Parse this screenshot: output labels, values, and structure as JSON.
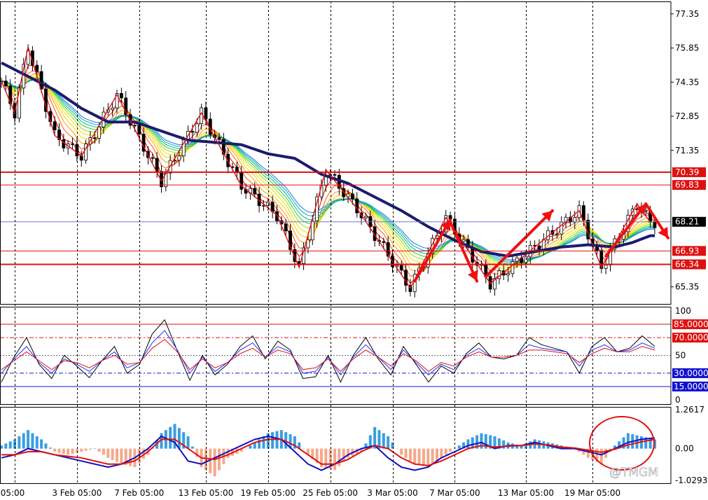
{
  "chart_data": {
    "type": "candlestick",
    "price_panel": {
      "ylim": [
        64.6,
        77.9
      ],
      "y_ticks": [
        "77.35",
        "75.85",
        "74.35",
        "72.85",
        "71.35",
        "65.35"
      ],
      "current_price": "68.21",
      "horizontal_levels": [
        {
          "value": 70.39,
          "label": "70.39",
          "color": "#e01010"
        },
        {
          "value": 69.83,
          "label": "69.83",
          "color": "#e01010"
        },
        {
          "value": 66.93,
          "label": "66.93",
          "color": "#e01010"
        },
        {
          "value": 66.34,
          "label": "66.34",
          "color": "#e01010"
        }
      ],
      "current_price_line": 68.21,
      "zigzag_points": [
        [
          0,
          74.4
        ],
        [
          3,
          73.0
        ],
        [
          6,
          75.9
        ],
        [
          12,
          72.0
        ],
        [
          18,
          71.1
        ],
        [
          26,
          73.8
        ],
        [
          36,
          70.0
        ],
        [
          45,
          73.0
        ],
        [
          54,
          69.8
        ],
        [
          62,
          68.5
        ],
        [
          67,
          66.2
        ],
        [
          73,
          70.5
        ],
        [
          80,
          68.8
        ],
        [
          92,
          65.3
        ],
        [
          100,
          68.4
        ],
        [
          110,
          65.5
        ],
        [
          130,
          68.7
        ],
        [
          135,
          66.2
        ],
        [
          143,
          69.0
        ],
        [
          146,
          68.2
        ]
      ],
      "moving_average": [
        [
          0,
          75.2
        ],
        [
          6,
          74.6
        ],
        [
          12,
          74.0
        ],
        [
          18,
          73.2
        ],
        [
          24,
          72.6
        ],
        [
          30,
          72.6
        ],
        [
          36,
          72.2
        ],
        [
          42,
          71.8
        ],
        [
          48,
          71.7
        ],
        [
          54,
          71.6
        ],
        [
          60,
          71.2
        ],
        [
          66,
          71.0
        ],
        [
          72,
          70.3
        ],
        [
          78,
          69.9
        ],
        [
          84,
          69.3
        ],
        [
          90,
          68.7
        ],
        [
          96,
          68.0
        ],
        [
          102,
          67.4
        ],
        [
          108,
          66.9
        ],
        [
          114,
          66.7
        ],
        [
          120,
          66.9
        ],
        [
          126,
          67.1
        ],
        [
          132,
          67.2
        ],
        [
          138,
          67.1
        ],
        [
          142,
          67.3
        ],
        [
          146,
          67.6
        ]
      ],
      "arrows": [
        {
          "from": [
            93,
            65.6
          ],
          "to": [
            101,
            68.3
          ]
        },
        {
          "from": [
            101,
            68.2
          ],
          "to": [
            107,
            65.6
          ]
        },
        {
          "from": [
            109,
            65.8
          ],
          "to": [
            124,
            68.7
          ]
        },
        {
          "from": [
            136,
            66.7
          ],
          "to": [
            145,
            69.0
          ]
        },
        {
          "from": [
            145,
            69.0
          ],
          "to": [
            150,
            67.5
          ]
        }
      ]
    },
    "stochastic_panel": {
      "ylim": [
        0,
        100
      ],
      "y_ticks": [
        "100",
        "50",
        "0"
      ],
      "levels": [
        {
          "value": 85,
          "label": "85.0000",
          "color": "#e01010"
        },
        {
          "value": 70,
          "label": "70.0000",
          "color": "#e01010"
        },
        {
          "value": 30,
          "label": "30.0000",
          "color": "#1010d0"
        },
        {
          "value": 15,
          "label": "15.0000",
          "color": "#1010d0"
        }
      ],
      "series": [
        {
          "color": "#000000",
          "values": [
            20,
            48,
            70,
            40,
            24,
            50,
            38,
            25,
            44,
            60,
            30,
            40,
            74,
            90,
            55,
            22,
            50,
            28,
            40,
            60,
            72,
            46,
            66,
            56,
            24,
            26,
            50,
            20,
            50,
            70,
            46,
            28,
            60,
            40,
            20,
            38,
            30,
            52,
            64,
            48,
            46,
            50,
            70,
            62,
            58,
            54,
            30,
            60,
            70,
            54,
            58,
            72,
            60
          ]
        },
        {
          "color": "#1f2dff",
          "values": [
            30,
            46,
            60,
            42,
            30,
            46,
            40,
            32,
            44,
            54,
            36,
            42,
            64,
            78,
            56,
            30,
            48,
            32,
            42,
            56,
            64,
            48,
            60,
            54,
            30,
            32,
            48,
            28,
            48,
            62,
            48,
            34,
            56,
            42,
            28,
            40,
            34,
            50,
            58,
            48,
            48,
            50,
            62,
            58,
            56,
            54,
            38,
            56,
            62,
            54,
            56,
            64,
            58
          ]
        },
        {
          "color": "#e01010",
          "values": [
            34,
            44,
            54,
            44,
            34,
            44,
            42,
            36,
            44,
            50,
            40,
            42,
            58,
            68,
            54,
            34,
            46,
            36,
            42,
            52,
            58,
            48,
            56,
            52,
            34,
            36,
            46,
            32,
            46,
            56,
            48,
            38,
            52,
            44,
            32,
            42,
            38,
            48,
            54,
            48,
            48,
            50,
            56,
            56,
            54,
            52,
            42,
            52,
            58,
            54,
            54,
            60,
            56
          ]
        }
      ]
    },
    "macd_panel": {
      "ylim": [
        -1.0293,
        1.2617
      ],
      "y_ticks": [
        "1.2617",
        "0.00",
        "-1.0293"
      ],
      "histogram": [
        0.1,
        0.3,
        0.6,
        0.3,
        -0.1,
        -0.2,
        -0.1,
        0.0,
        -0.3,
        -0.5,
        -0.6,
        -0.2,
        0.5,
        0.8,
        0.4,
        -0.6,
        -0.9,
        -0.3,
        -0.1,
        0.2,
        0.5,
        0.6,
        0.4,
        -0.2,
        -0.6,
        -0.7,
        -0.3,
        -0.1,
        0.7,
        0.4,
        -0.2,
        -0.5,
        -0.6,
        -0.3,
        0.0,
        0.3,
        0.5,
        0.4,
        0.2,
        0.1,
        0.3,
        0.2,
        0.1,
        0.0,
        -0.3,
        -0.5,
        0.1,
        0.5,
        0.4,
        0.3
      ],
      "macd_line": [
        -0.3,
        -0.2,
        0.0,
        -0.1,
        -0.2,
        -0.3,
        -0.4,
        -0.5,
        -0.6,
        -0.5,
        -0.3,
        0.0,
        0.4,
        0.2,
        -0.4,
        -0.5,
        -0.3,
        -0.1,
        0.1,
        0.3,
        0.4,
        0.3,
        -0.1,
        -0.5,
        -0.7,
        -0.5,
        -0.2,
        0.0,
        0.1,
        -0.3,
        -0.6,
        -0.7,
        -0.6,
        -0.3,
        -0.1,
        0.1,
        0.2,
        0.0,
        0.1,
        0.1,
        0.2,
        0.1,
        0.0,
        0.0,
        -0.1,
        -0.2,
        0.0,
        0.2,
        0.3,
        0.35
      ],
      "signal_line": [
        -0.2,
        -0.2,
        -0.1,
        -0.1,
        -0.2,
        -0.25,
        -0.3,
        -0.4,
        -0.5,
        -0.5,
        -0.4,
        -0.1,
        0.3,
        0.3,
        0.0,
        -0.3,
        -0.35,
        -0.2,
        0.0,
        0.2,
        0.3,
        0.3,
        0.1,
        -0.2,
        -0.5,
        -0.5,
        -0.35,
        -0.1,
        0.1,
        0.0,
        -0.3,
        -0.5,
        -0.55,
        -0.4,
        -0.2,
        0.0,
        0.1,
        0.05,
        0.08,
        0.1,
        0.15,
        0.12,
        0.05,
        0.02,
        -0.05,
        -0.12,
        -0.02,
        0.12,
        0.22,
        0.3
      ]
    },
    "x_ticks": [
      "05:00",
      "3 Feb 05:00",
      "7 Feb 05:00",
      "13 Feb 05:00",
      "19 Feb 05:00",
      "25 Feb 05:00",
      "3 Mar 05:00",
      "7 Mar 05:00",
      "13 Mar 05:00",
      "19 Mar 05:00"
    ],
    "watermark": "@TMGM"
  },
  "colors": {
    "up_candle": "#000000",
    "down_candle": "#000000",
    "moving_average": "#1b1b6e",
    "zigzag": "#e01010",
    "arrow": "#f01010",
    "histogram_up": "#3a9ee0",
    "histogram_down": "#f4a98a",
    "macd_line": "#1010c0",
    "signal_line": "#e01010",
    "vertical_grid": "#000000"
  }
}
